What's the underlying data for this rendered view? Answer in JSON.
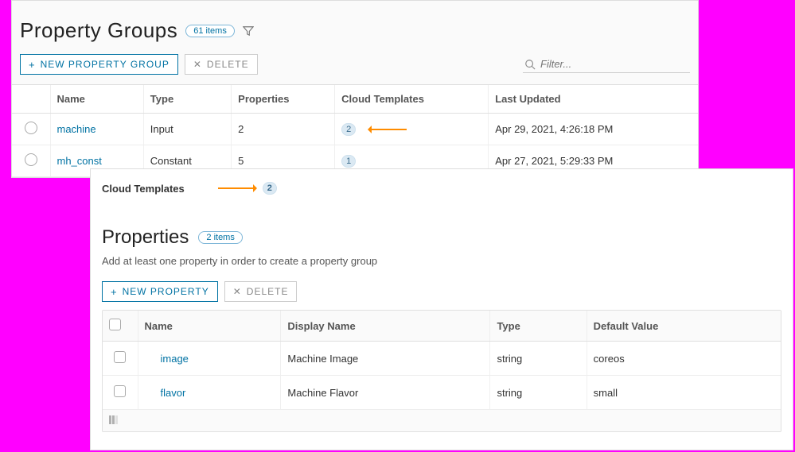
{
  "header": {
    "title": "Property Groups",
    "count_label": "61 items",
    "filter_placeholder": "Filter..."
  },
  "actions": {
    "new_group": "NEW PROPERTY GROUP",
    "delete": "DELETE"
  },
  "grid": {
    "columns": {
      "name": "Name",
      "type": "Type",
      "properties": "Properties",
      "cloud_templates": "Cloud Templates",
      "last_updated": "Last Updated"
    },
    "rows": [
      {
        "name": "machine",
        "type": "Input",
        "properties": "2",
        "cloud_templates": "2",
        "last_updated": "Apr 29, 2021, 4:26:18 PM"
      },
      {
        "name": "mh_const",
        "type": "Constant",
        "properties": "5",
        "cloud_templates": "1",
        "last_updated": "Apr 27, 2021, 5:29:33 PM"
      }
    ]
  },
  "detail": {
    "cloud_templates_label": "Cloud Templates",
    "cloud_templates_count": "2",
    "properties_title": "Properties",
    "properties_count_label": "2 items",
    "help_text": "Add at least one property in order to create a property group",
    "new_property": "NEW PROPERTY",
    "delete": "DELETE",
    "columns": {
      "name": "Name",
      "display_name": "Display Name",
      "type": "Type",
      "default_value": "Default Value"
    },
    "rows": [
      {
        "name": "image",
        "display_name": "Machine Image",
        "type": "string",
        "default_value": "coreos"
      },
      {
        "name": "flavor",
        "display_name": "Machine Flavor",
        "type": "string",
        "default_value": "small"
      }
    ]
  }
}
